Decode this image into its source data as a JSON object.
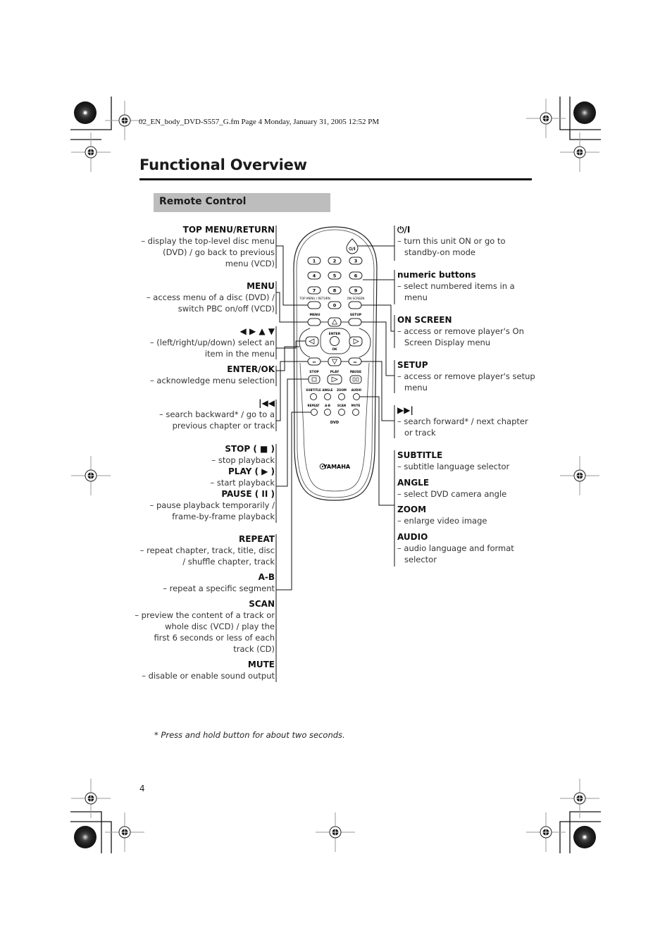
{
  "header": {
    "file_line": "02_EN_body_DVD-S557_G.fm  Page 4  Monday, January 31, 2005  12:52 PM"
  },
  "page": {
    "title": "Functional Overview",
    "section": "Remote Control",
    "page_number": "4",
    "footnote": "* Press and hold button for about two seconds."
  },
  "left_callouts": [
    {
      "heading": "TOP MENU/RETURN",
      "lines": [
        "– display the top-level disc menu",
        "(DVD) / go back to previous",
        "menu (VCD)"
      ]
    },
    {
      "heading": "MENU",
      "lines": [
        "– access menu of a disc (DVD) /",
        "switch PBC on/off (VCD)"
      ]
    },
    {
      "heading": "◀ ▶ ▲ ▼",
      "lines": [
        "– (left/right/up/down) select an",
        "item in the menu"
      ]
    },
    {
      "heading": "ENTER/OK",
      "lines": [
        "– acknowledge menu selection"
      ]
    },
    {
      "heading": "|◀◀",
      "lines": [
        "– search backward* / go to a",
        "previous chapter or track"
      ]
    },
    {
      "heading": "STOP ( ■ )",
      "lines": [
        "– stop playback"
      ]
    },
    {
      "heading": "PLAY ( ▶ )",
      "lines": [
        "– start playback"
      ]
    },
    {
      "heading": "PAUSE ( II )",
      "lines": [
        "– pause playback temporarily /",
        "frame-by-frame playback"
      ]
    },
    {
      "heading": "REPEAT",
      "lines": [
        "– repeat chapter, track, title, disc",
        "/ shuffle chapter, track"
      ]
    },
    {
      "heading": "A-B",
      "lines": [
        "– repeat a specific segment"
      ]
    },
    {
      "heading": "SCAN",
      "lines": [
        "– preview the content of a track or",
        "whole disc (VCD) / play the",
        "first 6 seconds or less of each",
        "track (CD)"
      ]
    },
    {
      "heading": "MUTE",
      "lines": [
        "– disable or enable sound output"
      ]
    }
  ],
  "right_callouts": [
    {
      "heading": "⏻/I",
      "lines": [
        "– turn this unit ON or go to",
        "standby-on mode"
      ]
    },
    {
      "heading": "numeric buttons",
      "lines": [
        "– select numbered items in a",
        "menu"
      ]
    },
    {
      "heading": "ON SCREEN",
      "lines": [
        "– access or remove player's On",
        "Screen Display menu"
      ]
    },
    {
      "heading": "SETUP",
      "lines": [
        "– access or remove player's setup",
        "menu"
      ]
    },
    {
      "heading": "▶▶|",
      "lines": [
        "– search forward* / next chapter",
        "or track"
      ]
    },
    {
      "heading": "SUBTITLE",
      "lines": [
        "– subtitle language selector"
      ]
    },
    {
      "heading": "ANGLE",
      "lines": [
        "– select DVD camera angle"
      ]
    },
    {
      "heading": "ZOOM",
      "lines": [
        "– enlarge video image"
      ]
    },
    {
      "heading": "AUDIO",
      "lines": [
        "– audio language and format",
        "selector"
      ]
    }
  ],
  "remote": {
    "power_label": "⏻/I",
    "digits": [
      "1",
      "2",
      "3",
      "4",
      "5",
      "6",
      "7",
      "8",
      "9",
      "0"
    ],
    "top_menu_label": "TOP MENU / RETURN",
    "on_screen_label": "ON SCREEN",
    "menu_label": "MENU",
    "setup_label": "SETUP",
    "enter_label": "ENTER",
    "ok_label": "OK",
    "stop_label": "STOP",
    "play_label": "PLAY",
    "pause_label": "PAUSE",
    "subtitle_label": "SUBTITLE",
    "angle_label": "ANGLE",
    "zoom_label": "ZOOM",
    "audio_label": "AUDIO",
    "repeat_label": "REPEAT",
    "ab_label": "A-B",
    "scan_label": "SCAN",
    "mute_label": "MUTE",
    "dvd_label": "DVD",
    "brand": "YAMAHA"
  }
}
